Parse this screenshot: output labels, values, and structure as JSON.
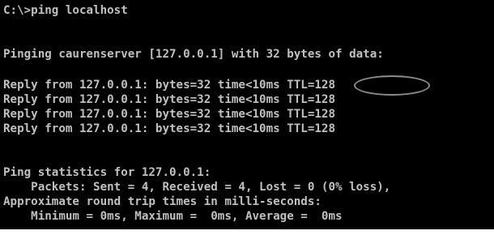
{
  "console": {
    "background": "#000000",
    "text_color": "#c0c0c0",
    "annotation_color": "#8a8a8a",
    "lines": [
      "C:\\>ping localhost",
      "",
      "Pinging caurenserver [127.0.0.1] with 32 bytes of data:",
      "",
      "Reply from 127.0.0.1: bytes=32 time<10ms TTL=128",
      "Reply from 127.0.0.1: bytes=32 time<10ms TTL=128",
      "Reply from 127.0.0.1: bytes=32 time<10ms TTL=128",
      "Reply from 127.0.0.1: bytes=32 time<10ms TTL=128",
      "",
      "Ping statistics for 127.0.0.1:",
      "    Packets: Sent = 4, Received = 4, Lost = 0 (0% loss),",
      "Approximate round trip times in milli-seconds:",
      "    Minimum = 0ms, Maximum =  0ms, Average =  0ms"
    ]
  }
}
